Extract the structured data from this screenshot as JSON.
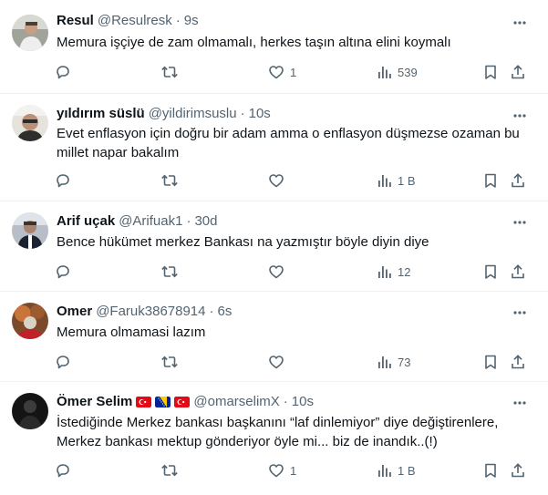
{
  "tweets": [
    {
      "name": "Resul",
      "handle": "@Resulresk",
      "separator": "·",
      "time": "9s",
      "lines": [
        "Memura işçiye de zam olmamalı, herkes taşın altına elini koymalı"
      ],
      "likes": "1",
      "views": "539"
    },
    {
      "name": "yıldırım süslü",
      "handle": "@yildirimsuslu",
      "separator": "·",
      "time": "10s",
      "lines": [
        "Evet enflasyon için doğru bir adam amma o enflasyon düşmezse ozaman bu",
        "millet napar bakalım"
      ],
      "likes": "",
      "views": "1 B"
    },
    {
      "name": "Arif uçak",
      "handle": "@Arifuak1",
      "separator": "·",
      "time": "30d",
      "lines": [
        "Bence hükümet merkez Bankası na yazmıştır böyle diyin diye"
      ],
      "likes": "",
      "views": "12"
    },
    {
      "name": "Omer",
      "handle": "@Faruk38678914",
      "separator": "·",
      "time": "6s",
      "lines": [
        "Memura olmamasi lazım"
      ],
      "likes": "",
      "views": "73"
    },
    {
      "name": "Ömer Selim",
      "handle": "@omarselimX",
      "separator": "·",
      "time": "10s",
      "lines": [
        "İstediğinde Merkez bankası başkanını “laf dinlemiyor” diye değiştirenlere,",
        "Merkez bankası mektup gönderiyor öyle mi... biz de inandık..(!)"
      ],
      "likes": "1",
      "views": "1 B"
    }
  ],
  "icons": {
    "more": "more-dots-icon",
    "reply": "reply-icon",
    "retweet": "retweet-icon",
    "like": "heart-icon",
    "views": "views-bar-chart-icon",
    "bookmark": "bookmark-icon",
    "share": "share-icon"
  },
  "flags": [
    "turkey-flag",
    "bosnia-flag",
    "turkey-flag"
  ],
  "colors": {
    "text": "#0f1419",
    "secondary": "#536471",
    "divider": "#eff3f4"
  }
}
